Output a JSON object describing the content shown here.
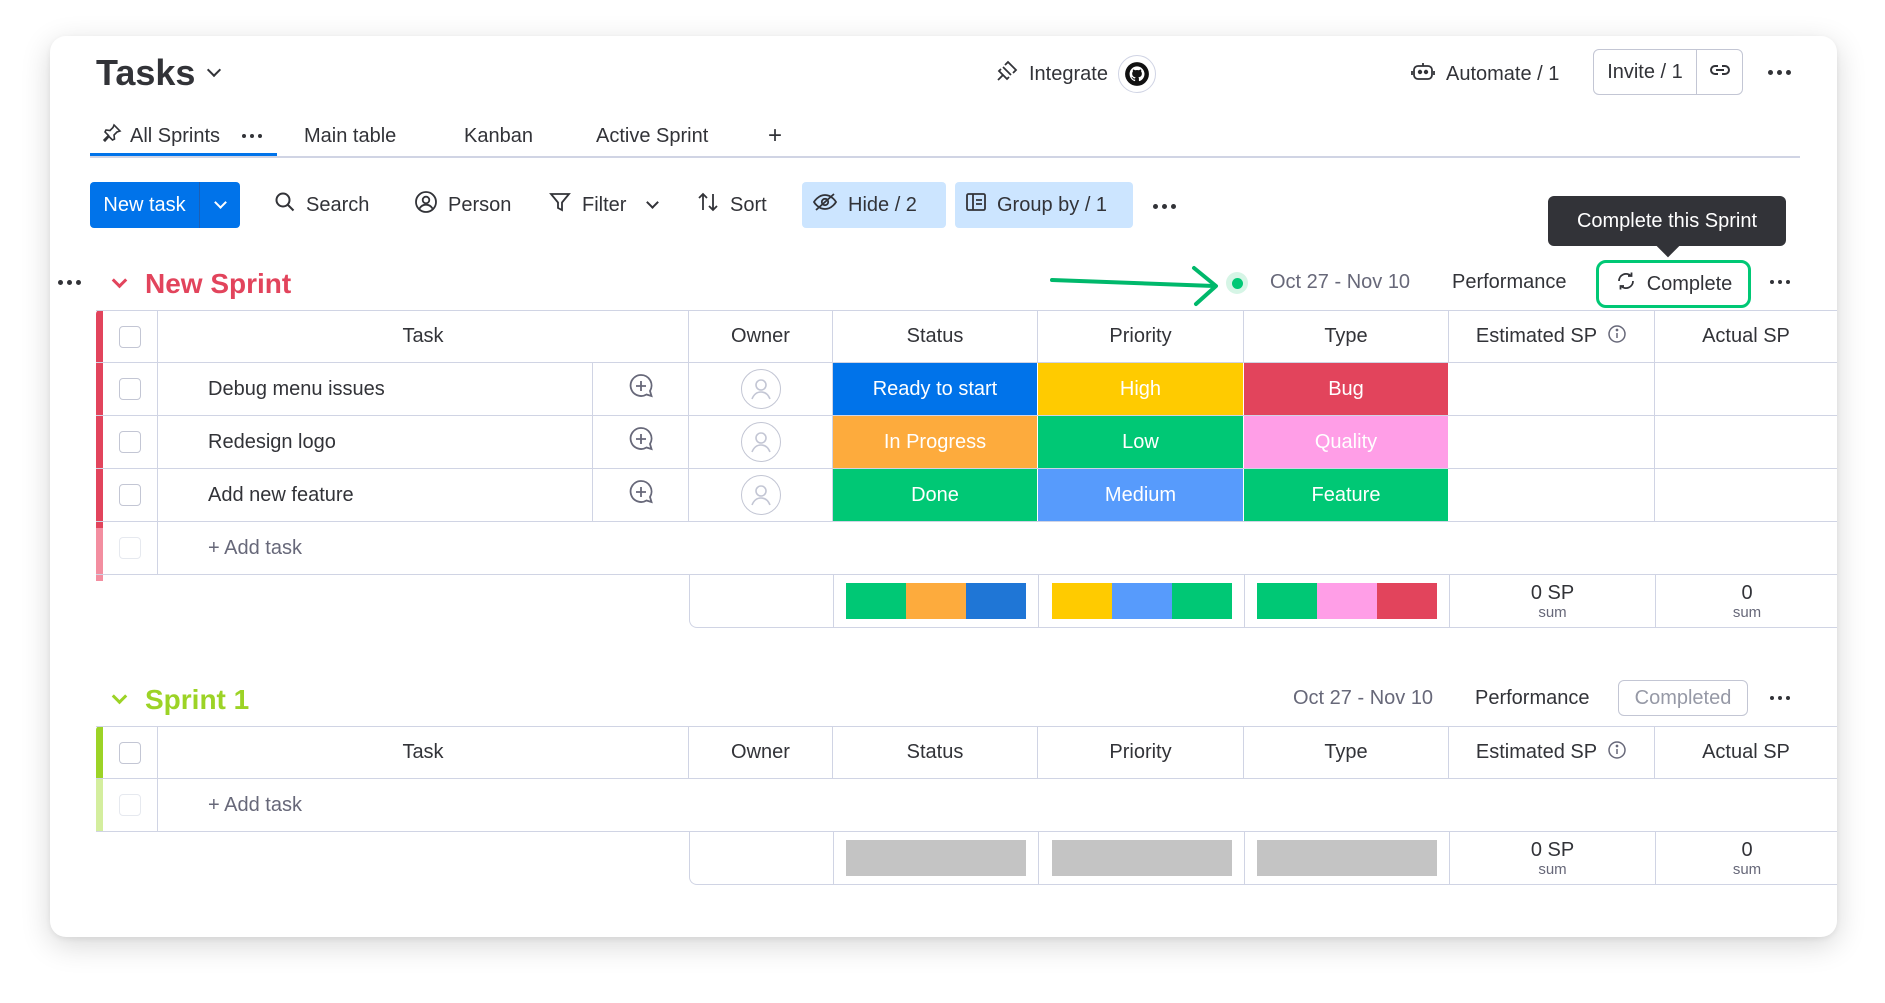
{
  "header": {
    "title": "Tasks",
    "integrate_label": "Integrate",
    "automate_label": "Automate / 1",
    "invite_label": "Invite / 1"
  },
  "tabs": [
    {
      "label": "All Sprints",
      "active": true
    },
    {
      "label": "Main table"
    },
    {
      "label": "Kanban"
    },
    {
      "label": "Active Sprint"
    }
  ],
  "tab_add": "+",
  "toolbar": {
    "new_task": "New task",
    "search": "Search",
    "person": "Person",
    "filter": "Filter",
    "sort": "Sort",
    "hide": "Hide / 2",
    "group_by": "Group by / 1"
  },
  "tooltip": "Complete this Sprint",
  "columns": {
    "task": "Task",
    "owner": "Owner",
    "status": "Status",
    "priority": "Priority",
    "type": "Type",
    "estimated_sp": "Estimated SP",
    "actual_sp": "Actual SP"
  },
  "groups": [
    {
      "title": "New Sprint",
      "color": "#e2445c",
      "dates": "Oct 27 - Nov 10",
      "performance": "Performance",
      "action": "Complete",
      "rows": [
        {
          "task": "Debug menu issues",
          "status": "Ready to start",
          "status_color": "#0073ea",
          "priority": "High",
          "priority_color": "#ffcb00",
          "type": "Bug",
          "type_color": "#e2445c"
        },
        {
          "task": "Redesign logo",
          "status": "In Progress",
          "status_color": "#fdab3d",
          "priority": "Low",
          "priority_color": "#00c875",
          "type": "Quality",
          "type_color": "#ff9ee7"
        },
        {
          "task": "Add new feature",
          "status": "Done",
          "status_color": "#00c875",
          "priority": "Medium",
          "priority_color": "#579bfc",
          "type": "Feature",
          "type_color": "#00c875"
        }
      ],
      "add_task": "+ Add task",
      "summary": {
        "status_colors": [
          "#00c875",
          "#fdab3d",
          "#1f76d6"
        ],
        "priority_colors": [
          "#ffcb00",
          "#579bfc",
          "#00c875"
        ],
        "type_colors": [
          "#00c875",
          "#ff9ee7",
          "#e2445c"
        ],
        "estimated": "0 SP",
        "estimated_sub": "sum",
        "actual": "0",
        "actual_sub": "sum"
      }
    },
    {
      "title": "Sprint 1",
      "color": "#9cd326",
      "dates": "Oct 27 - Nov 10",
      "performance": "Performance",
      "action": "Completed",
      "rows": [],
      "add_task": "+ Add task",
      "summary": {
        "estimated": "0 SP",
        "estimated_sub": "sum",
        "actual": "0",
        "actual_sub": "sum"
      }
    }
  ]
}
